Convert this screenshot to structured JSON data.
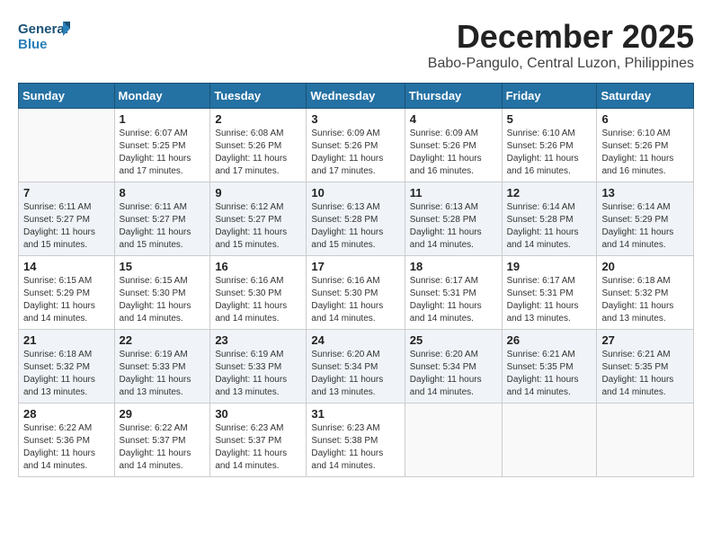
{
  "logo": {
    "line1": "General",
    "line2": "Blue"
  },
  "title": "December 2025",
  "subtitle": "Babo-Pangulo, Central Luzon, Philippines",
  "header": {
    "days": [
      "Sunday",
      "Monday",
      "Tuesday",
      "Wednesday",
      "Thursday",
      "Friday",
      "Saturday"
    ]
  },
  "weeks": [
    {
      "cells": [
        {
          "day": "",
          "info": ""
        },
        {
          "day": "1",
          "info": "Sunrise: 6:07 AM\nSunset: 5:25 PM\nDaylight: 11 hours\nand 17 minutes."
        },
        {
          "day": "2",
          "info": "Sunrise: 6:08 AM\nSunset: 5:26 PM\nDaylight: 11 hours\nand 17 minutes."
        },
        {
          "day": "3",
          "info": "Sunrise: 6:09 AM\nSunset: 5:26 PM\nDaylight: 11 hours\nand 17 minutes."
        },
        {
          "day": "4",
          "info": "Sunrise: 6:09 AM\nSunset: 5:26 PM\nDaylight: 11 hours\nand 16 minutes."
        },
        {
          "day": "5",
          "info": "Sunrise: 6:10 AM\nSunset: 5:26 PM\nDaylight: 11 hours\nand 16 minutes."
        },
        {
          "day": "6",
          "info": "Sunrise: 6:10 AM\nSunset: 5:26 PM\nDaylight: 11 hours\nand 16 minutes."
        }
      ]
    },
    {
      "cells": [
        {
          "day": "7",
          "info": "Sunrise: 6:11 AM\nSunset: 5:27 PM\nDaylight: 11 hours\nand 15 minutes."
        },
        {
          "day": "8",
          "info": "Sunrise: 6:11 AM\nSunset: 5:27 PM\nDaylight: 11 hours\nand 15 minutes."
        },
        {
          "day": "9",
          "info": "Sunrise: 6:12 AM\nSunset: 5:27 PM\nDaylight: 11 hours\nand 15 minutes."
        },
        {
          "day": "10",
          "info": "Sunrise: 6:13 AM\nSunset: 5:28 PM\nDaylight: 11 hours\nand 15 minutes."
        },
        {
          "day": "11",
          "info": "Sunrise: 6:13 AM\nSunset: 5:28 PM\nDaylight: 11 hours\nand 14 minutes."
        },
        {
          "day": "12",
          "info": "Sunrise: 6:14 AM\nSunset: 5:28 PM\nDaylight: 11 hours\nand 14 minutes."
        },
        {
          "day": "13",
          "info": "Sunrise: 6:14 AM\nSunset: 5:29 PM\nDaylight: 11 hours\nand 14 minutes."
        }
      ]
    },
    {
      "cells": [
        {
          "day": "14",
          "info": "Sunrise: 6:15 AM\nSunset: 5:29 PM\nDaylight: 11 hours\nand 14 minutes."
        },
        {
          "day": "15",
          "info": "Sunrise: 6:15 AM\nSunset: 5:30 PM\nDaylight: 11 hours\nand 14 minutes."
        },
        {
          "day": "16",
          "info": "Sunrise: 6:16 AM\nSunset: 5:30 PM\nDaylight: 11 hours\nand 14 minutes."
        },
        {
          "day": "17",
          "info": "Sunrise: 6:16 AM\nSunset: 5:30 PM\nDaylight: 11 hours\nand 14 minutes."
        },
        {
          "day": "18",
          "info": "Sunrise: 6:17 AM\nSunset: 5:31 PM\nDaylight: 11 hours\nand 14 minutes."
        },
        {
          "day": "19",
          "info": "Sunrise: 6:17 AM\nSunset: 5:31 PM\nDaylight: 11 hours\nand 13 minutes."
        },
        {
          "day": "20",
          "info": "Sunrise: 6:18 AM\nSunset: 5:32 PM\nDaylight: 11 hours\nand 13 minutes."
        }
      ]
    },
    {
      "cells": [
        {
          "day": "21",
          "info": "Sunrise: 6:18 AM\nSunset: 5:32 PM\nDaylight: 11 hours\nand 13 minutes."
        },
        {
          "day": "22",
          "info": "Sunrise: 6:19 AM\nSunset: 5:33 PM\nDaylight: 11 hours\nand 13 minutes."
        },
        {
          "day": "23",
          "info": "Sunrise: 6:19 AM\nSunset: 5:33 PM\nDaylight: 11 hours\nand 13 minutes."
        },
        {
          "day": "24",
          "info": "Sunrise: 6:20 AM\nSunset: 5:34 PM\nDaylight: 11 hours\nand 13 minutes."
        },
        {
          "day": "25",
          "info": "Sunrise: 6:20 AM\nSunset: 5:34 PM\nDaylight: 11 hours\nand 14 minutes."
        },
        {
          "day": "26",
          "info": "Sunrise: 6:21 AM\nSunset: 5:35 PM\nDaylight: 11 hours\nand 14 minutes."
        },
        {
          "day": "27",
          "info": "Sunrise: 6:21 AM\nSunset: 5:35 PM\nDaylight: 11 hours\nand 14 minutes."
        }
      ]
    },
    {
      "cells": [
        {
          "day": "28",
          "info": "Sunrise: 6:22 AM\nSunset: 5:36 PM\nDaylight: 11 hours\nand 14 minutes."
        },
        {
          "day": "29",
          "info": "Sunrise: 6:22 AM\nSunset: 5:37 PM\nDaylight: 11 hours\nand 14 minutes."
        },
        {
          "day": "30",
          "info": "Sunrise: 6:23 AM\nSunset: 5:37 PM\nDaylight: 11 hours\nand 14 minutes."
        },
        {
          "day": "31",
          "info": "Sunrise: 6:23 AM\nSunset: 5:38 PM\nDaylight: 11 hours\nand 14 minutes."
        },
        {
          "day": "",
          "info": ""
        },
        {
          "day": "",
          "info": ""
        },
        {
          "day": "",
          "info": ""
        }
      ]
    }
  ]
}
